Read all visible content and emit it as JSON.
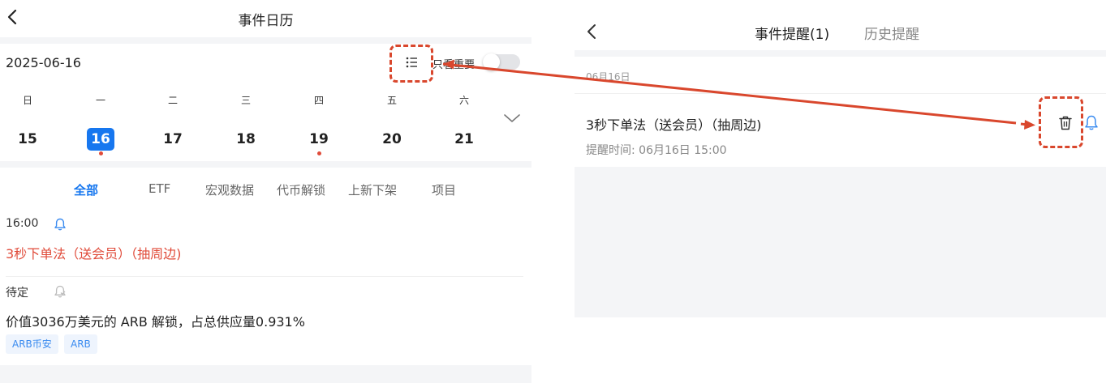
{
  "left": {
    "title": "事件日历",
    "date": "2025-06-16",
    "important_only_label": "只看重要",
    "important_only_on": false,
    "weekdays": [
      "日",
      "一",
      "二",
      "三",
      "四",
      "五",
      "六"
    ],
    "days": [
      "15",
      "16",
      "17",
      "18",
      "19",
      "20",
      "21"
    ],
    "selected_day": "16",
    "days_with_dot": [
      "16",
      "19"
    ],
    "tabs": [
      "全部",
      "ETF",
      "宏观数据",
      "代币解锁",
      "上新下架",
      "项目"
    ],
    "active_tab": "全部",
    "events": [
      {
        "time": "16:00",
        "title": "3秒下单法（送会员）（抽周边)",
        "highlight": true,
        "bell": "active"
      },
      {
        "time": "待定",
        "title": "价值3036万美元的 ARB 解锁，占总供应量0.931%",
        "highlight": false,
        "bell": "inactive",
        "tags": [
          "ARB币安",
          "ARB"
        ]
      }
    ]
  },
  "right": {
    "tab_active": "事件提醒(1)",
    "tab_history": "历史提醒",
    "date_header": "06月16日",
    "reminder": {
      "title": "3秒下单法（送会员）（抽周边)",
      "remind_time": "提醒时间: 06月16日 15:00"
    }
  },
  "colors": {
    "accent_blue": "#1777ef",
    "alert_red": "#e04b3a",
    "annotation_red": "#d9472d",
    "tag_blue": "#3a8bf0"
  },
  "icons": [
    "back-icon",
    "list-icon",
    "chevron-down-icon",
    "bell-icon",
    "bell-off-icon",
    "trash-icon"
  ]
}
